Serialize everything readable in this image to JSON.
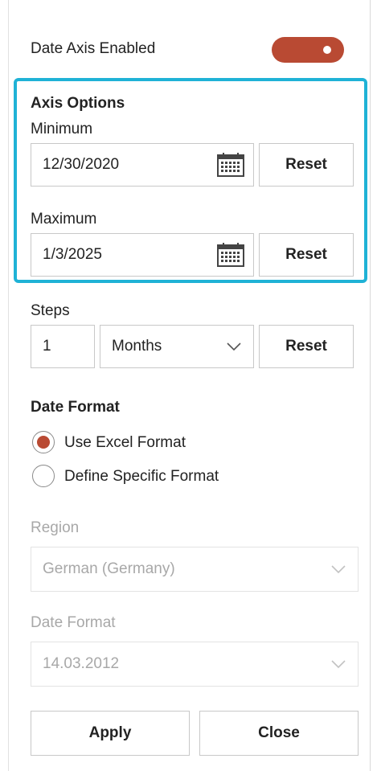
{
  "date_axis": {
    "label": "Date Axis Enabled",
    "enabled": true,
    "accent_color": "#b94a33"
  },
  "axis_options": {
    "title": "Axis Options",
    "highlight_color": "#1fb2d6",
    "minimum": {
      "label": "Minimum",
      "value": "12/30/2020",
      "reset_label": "Reset",
      "icon": "calendar-icon"
    },
    "maximum": {
      "label": "Maximum",
      "value": "1/3/2025",
      "reset_label": "Reset",
      "icon": "calendar-icon"
    }
  },
  "steps": {
    "label": "Steps",
    "value": "1",
    "unit": "Months",
    "reset_label": "Reset"
  },
  "date_format": {
    "title": "Date Format",
    "options": [
      {
        "label": "Use Excel Format",
        "selected": true
      },
      {
        "label": "Define Specific Format",
        "selected": false
      }
    ]
  },
  "region": {
    "label": "Region",
    "value": "German (Germany)"
  },
  "specific_format": {
    "label": "Date Format",
    "value": "14.03.2012"
  },
  "actions": {
    "apply_label": "Apply",
    "close_label": "Close"
  }
}
